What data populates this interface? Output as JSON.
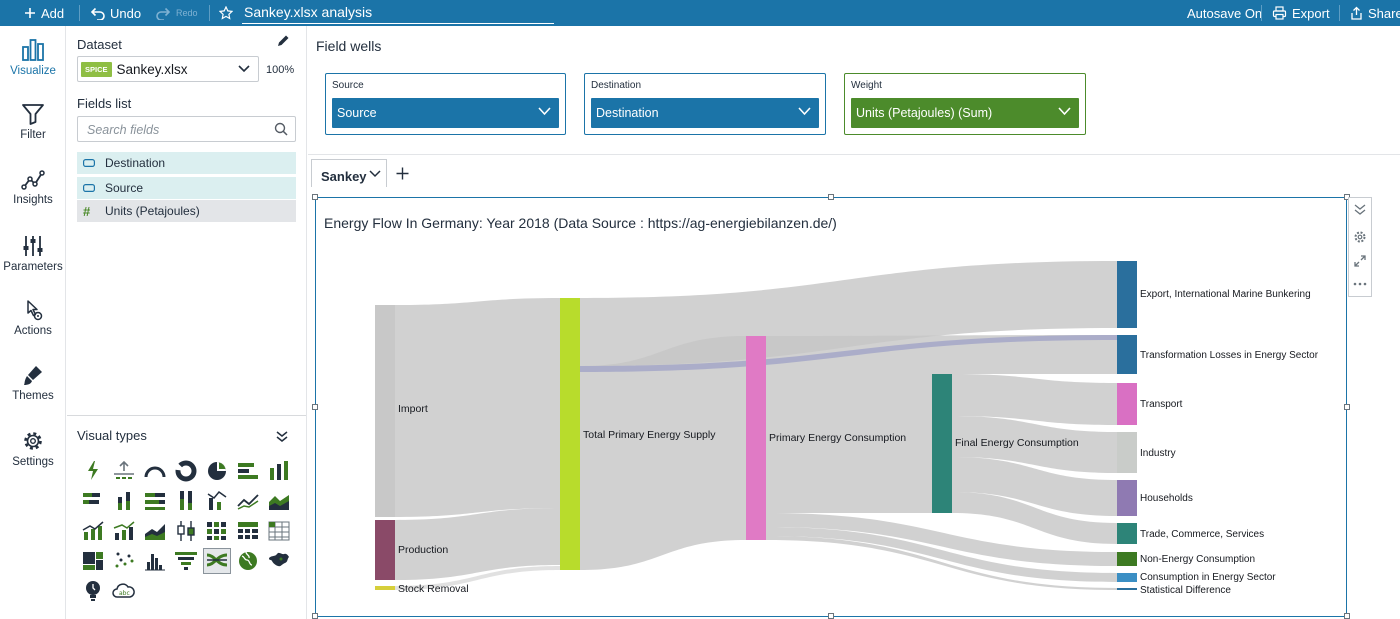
{
  "topbar": {
    "add_label": "Add",
    "undo_label": "Undo",
    "redo_label": "Redo",
    "title": "Sankey.xlsx analysis",
    "autosave_label": "Autosave On",
    "export_label": "Export",
    "share_label": "Share"
  },
  "rail": [
    {
      "label": "Visualize",
      "icon": "bar-chart-icon",
      "active": true
    },
    {
      "label": "Filter",
      "icon": "funnel-icon"
    },
    {
      "label": "Insights",
      "icon": "insights-icon"
    },
    {
      "label": "Parameters",
      "icon": "sliders-icon"
    },
    {
      "label": "Actions",
      "icon": "pointer-gear-icon"
    },
    {
      "label": "Themes",
      "icon": "brush-icon"
    },
    {
      "label": "Settings",
      "icon": "gear-icon"
    }
  ],
  "dataset": {
    "heading": "Dataset",
    "badge": "SPICE",
    "name": "Sankey.xlsx",
    "percent": "100%"
  },
  "fields": {
    "heading": "Fields list",
    "search_placeholder": "Search fields",
    "items": [
      {
        "label": "Destination",
        "kind": "dimension"
      },
      {
        "label": "Source",
        "kind": "dimension"
      },
      {
        "label": "Units (Petajoules)",
        "kind": "measure"
      }
    ]
  },
  "visual_types": {
    "heading": "Visual types",
    "selected": "sankey-diagram"
  },
  "field_wells": {
    "heading": "Field wells",
    "wells": [
      {
        "label": "Source",
        "value": "Source"
      },
      {
        "label": "Destination",
        "value": "Destination"
      },
      {
        "label": "Weight",
        "value": "Units (Petajoules) (Sum)"
      }
    ]
  },
  "sheet_tab": "Sankey",
  "visual": {
    "title": "Energy Flow In Germany: Year 2018 (Data Source : https://ag-energiebilanzen.de/)",
    "nodes": {
      "import": "Import",
      "production": "Production",
      "stock_removal": "Stock Removal",
      "tpes": "Total Primary Energy Supply",
      "pec": "Primary Energy Consumption",
      "fec": "Final Energy Consumption",
      "export": "Export, International Marine Bunkering",
      "transformation_losses": "Transformation Losses in Energy Sector",
      "transport": "Transport",
      "industry": "Industry",
      "households": "Households",
      "trade": "Trade, Commerce, Services",
      "non_energy": "Non-Energy Consumption",
      "consumption_sector": "Consumption in Energy Sector",
      "statistical_difference": "Statistical Difference"
    }
  },
  "colors": {
    "topbar": "#1b74a8",
    "weight_well": "#4c8b2b",
    "link": "#c5c5c5",
    "tpes_node": "#b8dc2c",
    "pec_node": "#e07ac5",
    "fec_node": "#2d8478"
  }
}
